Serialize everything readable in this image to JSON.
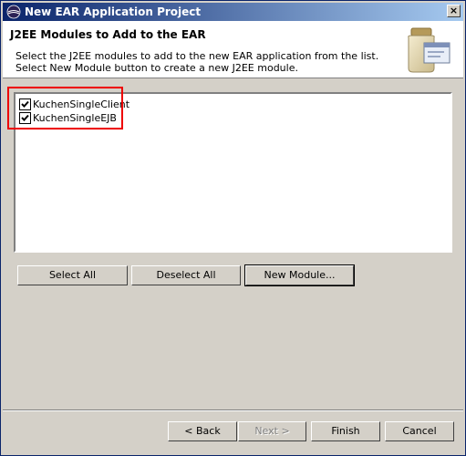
{
  "window": {
    "title": "New EAR Application Project",
    "close_icon": "×"
  },
  "banner": {
    "title": "J2EE Modules to Add to the EAR",
    "description_line1": "Select the J2EE modules to add to the new EAR application from the list.",
    "description_line2": "Select New Module button to create a new J2EE module."
  },
  "modules": [
    {
      "label": "KuchenSingleClient",
      "checked": true
    },
    {
      "label": "KuchenSingleEJB",
      "checked": true
    }
  ],
  "list_buttons": {
    "select_all": "Select All",
    "deselect_all": "Deselect All",
    "new_module": "New Module..."
  },
  "footer_buttons": {
    "back": "< Back",
    "next": "Next >",
    "finish": "Finish",
    "cancel": "Cancel"
  },
  "colors": {
    "highlight": "#ee0000",
    "title_gradient_start": "#0a246a",
    "title_gradient_end": "#a6caf0"
  }
}
